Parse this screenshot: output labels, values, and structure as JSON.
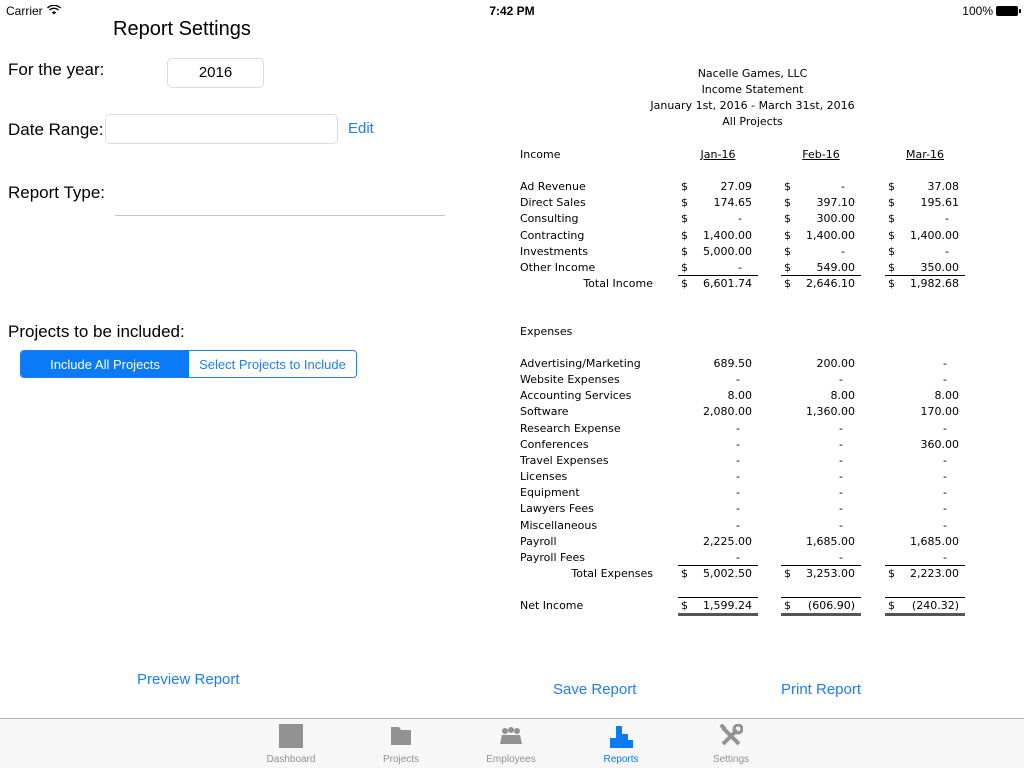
{
  "status_bar": {
    "carrier": "Carrier",
    "time": "7:42 PM",
    "battery": "100%"
  },
  "settings": {
    "title": "Report Settings",
    "year_label": "For the year:",
    "year_value": "2016",
    "date_range_label": "Date Range:",
    "date_range_value": "",
    "edit_label": "Edit",
    "report_type_label": "Report Type:",
    "projects_label": "Projects to be included:",
    "segments": [
      {
        "label": "Include All Projects",
        "selected": true
      },
      {
        "label": "Select Projects to Include",
        "selected": false
      }
    ],
    "preview_label": "Preview Report"
  },
  "actions": {
    "save_label": "Save Report",
    "print_label": "Print Report"
  },
  "report": {
    "company": "Nacelle Games, LLC",
    "statement": "Income Statement",
    "period": "January 1st, 2016 - March 31st, 2016",
    "scope": "All Projects",
    "income_header": "Income",
    "columns": [
      "Jan-16",
      "Feb-16",
      "Mar-16"
    ],
    "income_rows": [
      {
        "label": "Ad Revenue",
        "values": [
          "27.09",
          "-",
          "37.08"
        ]
      },
      {
        "label": "Direct Sales",
        "values": [
          "174.65",
          "397.10",
          "195.61"
        ]
      },
      {
        "label": "Consulting",
        "values": [
          "-",
          "300.00",
          "-"
        ]
      },
      {
        "label": "Contracting",
        "values": [
          "1,400.00",
          "1,400.00",
          "1,400.00"
        ]
      },
      {
        "label": "Investments",
        "values": [
          "5,000.00",
          "-",
          "-"
        ]
      },
      {
        "label": "Other Income",
        "values": [
          "-",
          "549.00",
          "350.00"
        ]
      }
    ],
    "total_income": {
      "label": "Total Income",
      "values": [
        "6,601.74",
        "2,646.10",
        "1,982.68"
      ]
    },
    "expenses_header": "Expenses",
    "expense_rows": [
      {
        "label": "Advertising/Marketing",
        "values": [
          "689.50",
          "200.00",
          "-"
        ]
      },
      {
        "label": "Website Expenses",
        "values": [
          "-",
          "-",
          "-"
        ]
      },
      {
        "label": "Accounting Services",
        "values": [
          "8.00",
          "8.00",
          "8.00"
        ]
      },
      {
        "label": "Software",
        "values": [
          "2,080.00",
          "1,360.00",
          "170.00"
        ]
      },
      {
        "label": "Research Expense",
        "values": [
          "-",
          "-",
          "-"
        ]
      },
      {
        "label": "Conferences",
        "values": [
          "-",
          "-",
          "360.00"
        ]
      },
      {
        "label": "Travel Expenses",
        "values": [
          "-",
          "-",
          "-"
        ]
      },
      {
        "label": "Licenses",
        "values": [
          "-",
          "-",
          "-"
        ]
      },
      {
        "label": "Equipment",
        "values": [
          "-",
          "-",
          "-"
        ]
      },
      {
        "label": "Lawyers Fees",
        "values": [
          "-",
          "-",
          "-"
        ]
      },
      {
        "label": "Miscellaneous",
        "values": [
          "-",
          "-",
          "-"
        ]
      },
      {
        "label": "Payroll",
        "values": [
          "2,225.00",
          "1,685.00",
          "1,685.00"
        ]
      },
      {
        "label": "Payroll Fees",
        "values": [
          "-",
          "-",
          "-"
        ]
      }
    ],
    "total_expenses": {
      "label": "Total Expenses",
      "values": [
        "5,002.50",
        "3,253.00",
        "2,223.00"
      ]
    },
    "net_income": {
      "label": "Net Income",
      "values": [
        "1,599.24",
        "(606.90)",
        "(240.32)"
      ]
    },
    "currency_symbol": "$"
  },
  "tabs": [
    {
      "label": "Dashboard",
      "icon": "dashboard-icon",
      "active": false
    },
    {
      "label": "Projects",
      "icon": "folder-icon",
      "active": false
    },
    {
      "label": "Employees",
      "icon": "people-icon",
      "active": false
    },
    {
      "label": "Reports",
      "icon": "chart-icon",
      "active": true
    },
    {
      "label": "Settings",
      "icon": "tools-icon",
      "active": false
    }
  ],
  "colors": {
    "accent": "#0a7af6",
    "inactive_tab": "#929292"
  }
}
